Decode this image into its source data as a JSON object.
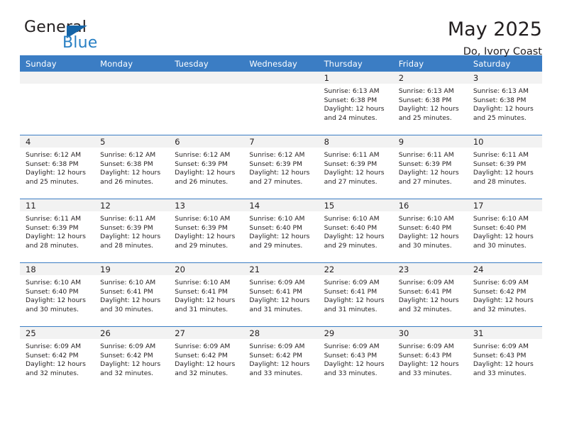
{
  "logo": {
    "word_top": "General",
    "word_bottom": "Blue",
    "triangle_icon": "triangle-icon",
    "brand_blue": "#2980c4",
    "triangle_color": "#1565a8"
  },
  "header": {
    "title": "May 2025",
    "location": "Do, Ivory Coast"
  },
  "theme": {
    "header_bg": "#3b7dc4",
    "daynum_bg": "#f2f2f2",
    "text": "#231f20"
  },
  "weekdays": [
    "Sunday",
    "Monday",
    "Tuesday",
    "Wednesday",
    "Thursday",
    "Friday",
    "Saturday"
  ],
  "weeks": [
    [
      {
        "day": "",
        "sunrise": "",
        "sunset": "",
        "daylight1": "",
        "daylight2": ""
      },
      {
        "day": "",
        "sunrise": "",
        "sunset": "",
        "daylight1": "",
        "daylight2": ""
      },
      {
        "day": "",
        "sunrise": "",
        "sunset": "",
        "daylight1": "",
        "daylight2": ""
      },
      {
        "day": "",
        "sunrise": "",
        "sunset": "",
        "daylight1": "",
        "daylight2": ""
      },
      {
        "day": "1",
        "sunrise": "Sunrise: 6:13 AM",
        "sunset": "Sunset: 6:38 PM",
        "daylight1": "Daylight: 12 hours",
        "daylight2": "and 24 minutes."
      },
      {
        "day": "2",
        "sunrise": "Sunrise: 6:13 AM",
        "sunset": "Sunset: 6:38 PM",
        "daylight1": "Daylight: 12 hours",
        "daylight2": "and 25 minutes."
      },
      {
        "day": "3",
        "sunrise": "Sunrise: 6:13 AM",
        "sunset": "Sunset: 6:38 PM",
        "daylight1": "Daylight: 12 hours",
        "daylight2": "and 25 minutes."
      }
    ],
    [
      {
        "day": "4",
        "sunrise": "Sunrise: 6:12 AM",
        "sunset": "Sunset: 6:38 PM",
        "daylight1": "Daylight: 12 hours",
        "daylight2": "and 25 minutes."
      },
      {
        "day": "5",
        "sunrise": "Sunrise: 6:12 AM",
        "sunset": "Sunset: 6:38 PM",
        "daylight1": "Daylight: 12 hours",
        "daylight2": "and 26 minutes."
      },
      {
        "day": "6",
        "sunrise": "Sunrise: 6:12 AM",
        "sunset": "Sunset: 6:39 PM",
        "daylight1": "Daylight: 12 hours",
        "daylight2": "and 26 minutes."
      },
      {
        "day": "7",
        "sunrise": "Sunrise: 6:12 AM",
        "sunset": "Sunset: 6:39 PM",
        "daylight1": "Daylight: 12 hours",
        "daylight2": "and 27 minutes."
      },
      {
        "day": "8",
        "sunrise": "Sunrise: 6:11 AM",
        "sunset": "Sunset: 6:39 PM",
        "daylight1": "Daylight: 12 hours",
        "daylight2": "and 27 minutes."
      },
      {
        "day": "9",
        "sunrise": "Sunrise: 6:11 AM",
        "sunset": "Sunset: 6:39 PM",
        "daylight1": "Daylight: 12 hours",
        "daylight2": "and 27 minutes."
      },
      {
        "day": "10",
        "sunrise": "Sunrise: 6:11 AM",
        "sunset": "Sunset: 6:39 PM",
        "daylight1": "Daylight: 12 hours",
        "daylight2": "and 28 minutes."
      }
    ],
    [
      {
        "day": "11",
        "sunrise": "Sunrise: 6:11 AM",
        "sunset": "Sunset: 6:39 PM",
        "daylight1": "Daylight: 12 hours",
        "daylight2": "and 28 minutes."
      },
      {
        "day": "12",
        "sunrise": "Sunrise: 6:11 AM",
        "sunset": "Sunset: 6:39 PM",
        "daylight1": "Daylight: 12 hours",
        "daylight2": "and 28 minutes."
      },
      {
        "day": "13",
        "sunrise": "Sunrise: 6:10 AM",
        "sunset": "Sunset: 6:39 PM",
        "daylight1": "Daylight: 12 hours",
        "daylight2": "and 29 minutes."
      },
      {
        "day": "14",
        "sunrise": "Sunrise: 6:10 AM",
        "sunset": "Sunset: 6:40 PM",
        "daylight1": "Daylight: 12 hours",
        "daylight2": "and 29 minutes."
      },
      {
        "day": "15",
        "sunrise": "Sunrise: 6:10 AM",
        "sunset": "Sunset: 6:40 PM",
        "daylight1": "Daylight: 12 hours",
        "daylight2": "and 29 minutes."
      },
      {
        "day": "16",
        "sunrise": "Sunrise: 6:10 AM",
        "sunset": "Sunset: 6:40 PM",
        "daylight1": "Daylight: 12 hours",
        "daylight2": "and 30 minutes."
      },
      {
        "day": "17",
        "sunrise": "Sunrise: 6:10 AM",
        "sunset": "Sunset: 6:40 PM",
        "daylight1": "Daylight: 12 hours",
        "daylight2": "and 30 minutes."
      }
    ],
    [
      {
        "day": "18",
        "sunrise": "Sunrise: 6:10 AM",
        "sunset": "Sunset: 6:40 PM",
        "daylight1": "Daylight: 12 hours",
        "daylight2": "and 30 minutes."
      },
      {
        "day": "19",
        "sunrise": "Sunrise: 6:10 AM",
        "sunset": "Sunset: 6:41 PM",
        "daylight1": "Daylight: 12 hours",
        "daylight2": "and 30 minutes."
      },
      {
        "day": "20",
        "sunrise": "Sunrise: 6:10 AM",
        "sunset": "Sunset: 6:41 PM",
        "daylight1": "Daylight: 12 hours",
        "daylight2": "and 31 minutes."
      },
      {
        "day": "21",
        "sunrise": "Sunrise: 6:09 AM",
        "sunset": "Sunset: 6:41 PM",
        "daylight1": "Daylight: 12 hours",
        "daylight2": "and 31 minutes."
      },
      {
        "day": "22",
        "sunrise": "Sunrise: 6:09 AM",
        "sunset": "Sunset: 6:41 PM",
        "daylight1": "Daylight: 12 hours",
        "daylight2": "and 31 minutes."
      },
      {
        "day": "23",
        "sunrise": "Sunrise: 6:09 AM",
        "sunset": "Sunset: 6:41 PM",
        "daylight1": "Daylight: 12 hours",
        "daylight2": "and 32 minutes."
      },
      {
        "day": "24",
        "sunrise": "Sunrise: 6:09 AM",
        "sunset": "Sunset: 6:42 PM",
        "daylight1": "Daylight: 12 hours",
        "daylight2": "and 32 minutes."
      }
    ],
    [
      {
        "day": "25",
        "sunrise": "Sunrise: 6:09 AM",
        "sunset": "Sunset: 6:42 PM",
        "daylight1": "Daylight: 12 hours",
        "daylight2": "and 32 minutes."
      },
      {
        "day": "26",
        "sunrise": "Sunrise: 6:09 AM",
        "sunset": "Sunset: 6:42 PM",
        "daylight1": "Daylight: 12 hours",
        "daylight2": "and 32 minutes."
      },
      {
        "day": "27",
        "sunrise": "Sunrise: 6:09 AM",
        "sunset": "Sunset: 6:42 PM",
        "daylight1": "Daylight: 12 hours",
        "daylight2": "and 32 minutes."
      },
      {
        "day": "28",
        "sunrise": "Sunrise: 6:09 AM",
        "sunset": "Sunset: 6:42 PM",
        "daylight1": "Daylight: 12 hours",
        "daylight2": "and 33 minutes."
      },
      {
        "day": "29",
        "sunrise": "Sunrise: 6:09 AM",
        "sunset": "Sunset: 6:43 PM",
        "daylight1": "Daylight: 12 hours",
        "daylight2": "and 33 minutes."
      },
      {
        "day": "30",
        "sunrise": "Sunrise: 6:09 AM",
        "sunset": "Sunset: 6:43 PM",
        "daylight1": "Daylight: 12 hours",
        "daylight2": "and 33 minutes."
      },
      {
        "day": "31",
        "sunrise": "Sunrise: 6:09 AM",
        "sunset": "Sunset: 6:43 PM",
        "daylight1": "Daylight: 12 hours",
        "daylight2": "and 33 minutes."
      }
    ]
  ]
}
